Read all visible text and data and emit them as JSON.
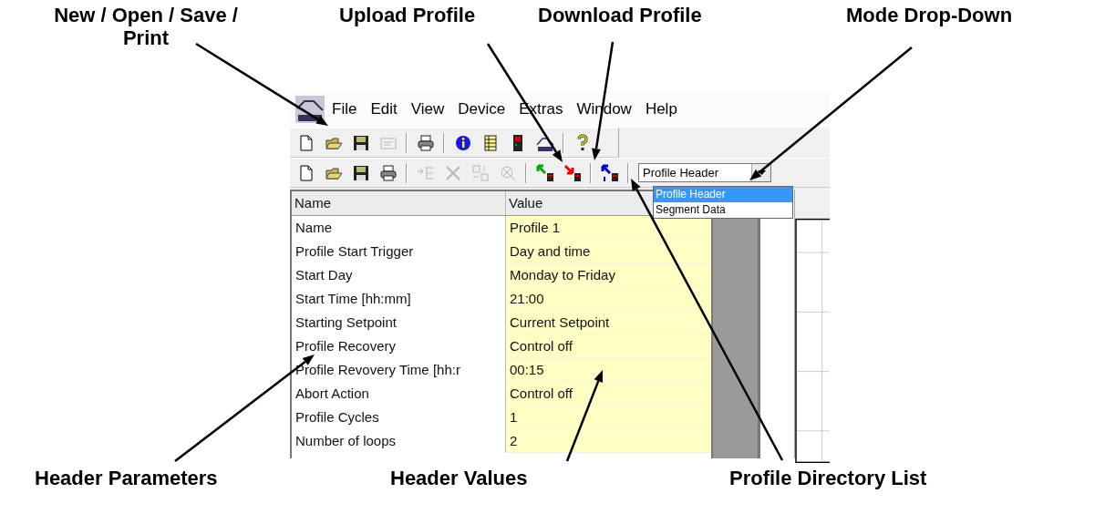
{
  "callouts": {
    "top": [
      "New / Open / Save / Print",
      "Upload Profile",
      "Download Profile",
      "Mode Drop-Down"
    ],
    "bottom": [
      "Header Parameters",
      "Header Values",
      "Profile Directory List"
    ]
  },
  "menu_bar": [
    "File",
    "Edit",
    "View",
    "Device",
    "Extras",
    "Window",
    "Help"
  ],
  "toolbar_1": [
    {
      "disabled": false
    },
    {
      "disabled": false
    },
    {
      "disabled": false
    },
    {
      "disabled": true
    },
    {
      "disabled": false
    },
    {
      "disabled": false
    },
    {
      "disabled": false
    },
    {
      "disabled": false
    },
    {
      "disabled": false
    },
    {
      "disabled": false
    }
  ],
  "toolbar_2": [
    {
      "disabled": false
    },
    {
      "disabled": false
    },
    {
      "disabled": false
    },
    {
      "disabled": false
    },
    {
      "disabled": true
    },
    {
      "disabled": true
    },
    {
      "disabled": true
    },
    {
      "disabled": true
    },
    {
      "disabled": false
    },
    {
      "disabled": false
    },
    {
      "disabled": false
    }
  ],
  "mode_dropdown": {
    "value": "Profile Header",
    "options": [
      {
        "label": "Profile Header",
        "selected": true
      },
      {
        "label": "Segment Data",
        "selected": false
      }
    ]
  },
  "table": {
    "columns": [
      "Name",
      "Value"
    ],
    "rows": [
      {
        "name": "Name",
        "value": "Profile 1"
      },
      {
        "name": "Profile Start Trigger",
        "value": "Day and time"
      },
      {
        "name": "Start Day",
        "value": "Monday to Friday"
      },
      {
        "name": "Start Time [hh:mm]",
        "value": "21:00"
      },
      {
        "name": "Starting Setpoint",
        "value": "Current Setpoint"
      },
      {
        "name": "Profile Recovery",
        "value": "Control off"
      },
      {
        "name": "Profile Revovery Time [hh:r",
        "value": "00:15"
      },
      {
        "name": "Abort Action",
        "value": "Control off"
      },
      {
        "name": "Profile Cycles",
        "value": "1"
      },
      {
        "name": "Number of loops",
        "value": "2"
      }
    ]
  }
}
